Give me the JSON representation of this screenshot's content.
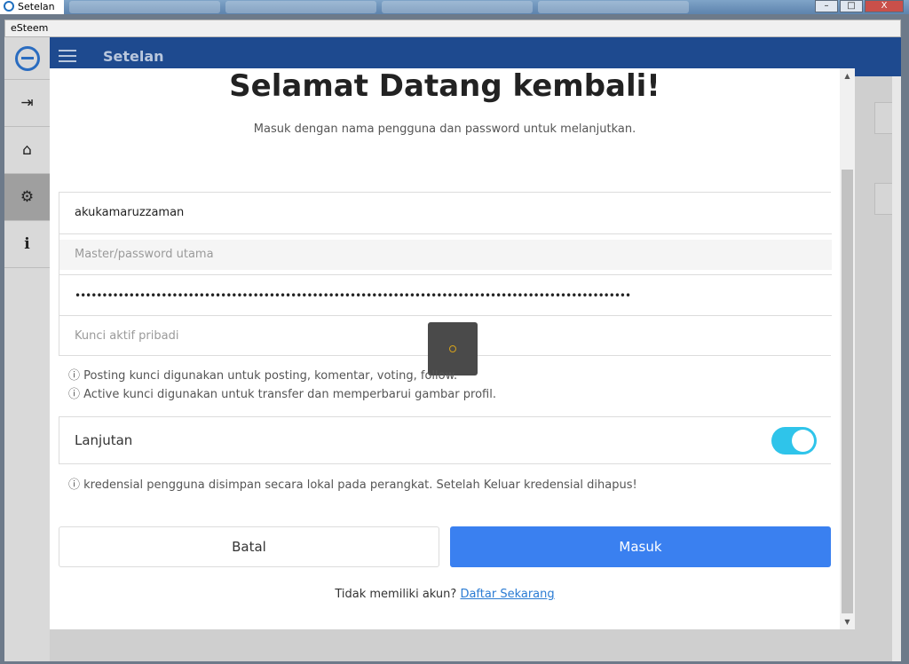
{
  "os": {
    "title": "Setelan",
    "buttons": {
      "minimize": "–",
      "maximize": "□",
      "close": "X"
    }
  },
  "app": {
    "window_title": "eSteem",
    "topbar_title": "Setelan",
    "sidebar": [
      {
        "icon": "login-icon",
        "glyph": "⇥"
      },
      {
        "icon": "home-icon",
        "glyph": "⌂"
      },
      {
        "icon": "gear-icon",
        "glyph": "⚙"
      },
      {
        "icon": "info-icon",
        "glyph": "i"
      }
    ]
  },
  "modal": {
    "title": "Selamat Datang kembali!",
    "subtitle": "Masuk dengan nama pengguna dan password untuk melanjutkan.",
    "username_value": "akukamaruzzaman",
    "master_placeholder": "Master/password utama",
    "posting_key_value": "•••••••••••••••••••••••••••••••••••••••••••••••••••••••••••••••••••••••••••••••••••••••••••••••••••••••",
    "active_key_placeholder": "Kunci aktif pribadi",
    "info_posting": "ⓘ Posting kunci digunakan untuk posting, komentar, voting, follow.",
    "info_active": "ⓘ Active kunci digunakan untuk transfer dan memperbarui gambar profil.",
    "advanced_label": "Lanjutan",
    "advanced_enabled": true,
    "info_credentials": "ⓘ kredensial pengguna disimpan secara lokal pada perangkat. Setelah Keluar kredensial dihapus!",
    "cancel_label": "Batal",
    "login_label": "Masuk",
    "no_account_text": "Tidak memiliki akun?",
    "register_link": "Daftar Sekarang"
  },
  "colors": {
    "topbar": "#1e4a8f",
    "primary_button": "#3a80f0",
    "toggle_on": "#2fc4ea",
    "link": "#2a7bd3"
  }
}
